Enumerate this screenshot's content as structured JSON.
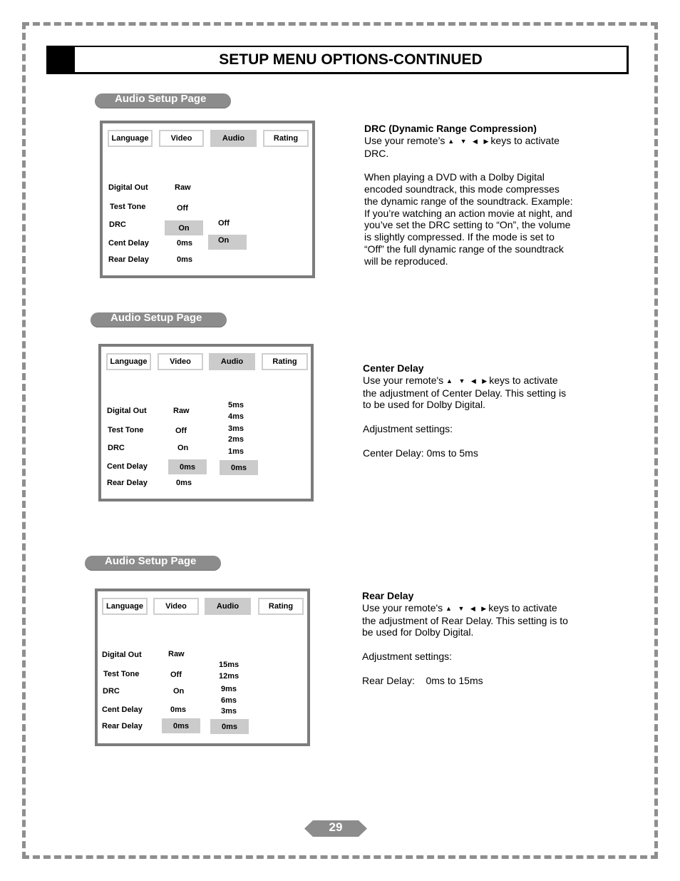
{
  "page": {
    "title": "SETUP MENU OPTIONS-CONTINUED",
    "page_number": "29"
  },
  "common": {
    "section_label": "Audio Setup Page",
    "tabs": [
      "Language",
      "Video",
      "Audio",
      "Rating"
    ],
    "active_tab": "Audio",
    "settings_labels": [
      "Digital Out",
      "Test Tone",
      "DRC",
      "Cent Delay",
      "Rear Delay"
    ],
    "arrow_keys": "▲ ▼ ◀ ▶"
  },
  "sections": [
    {
      "pill_label": "Audio Setup Page",
      "values": [
        "Raw",
        "Off",
        "On",
        "0ms",
        "0ms"
      ],
      "selected_setting": "DRC",
      "options": [
        "Off",
        "On"
      ],
      "selected_option": "On",
      "heading": "DRC (Dynamic Range Compression)",
      "line1_pre": "Use your remote’s",
      "line1_post": "keys to activate",
      "paragraph1_rest": "DRC.",
      "paragraph2": "When playing a DVD with a Dolby Digital encoded soundtrack, this mode compresses the dynamic range of the soundtrack. Example: If you’re watching an action movie at night, and you’ve set the DRC setting to “On”, the volume is slightly compressed.  If the mode is set to “Off” the full dynamic range of the soundtrack will be reproduced."
    },
    {
      "pill_label": "Audio Setup Page",
      "values": [
        "Raw",
        "Off",
        "On",
        "0ms",
        "0ms"
      ],
      "selected_setting": "Cent Delay",
      "options": [
        "5ms",
        "4ms",
        "3ms",
        "2ms",
        "1ms",
        "0ms"
      ],
      "selected_option": "0ms",
      "heading": "Center Delay",
      "line1_pre": "Use your remote's",
      "line1_post": "keys to activate",
      "paragraph1_rest": "the adjustment of Center Delay.  This setting is to be used for Dolby Digital.",
      "adjustment_label": "Adjustment settings:",
      "range_text": "Center Delay: 0ms to 5ms"
    },
    {
      "pill_label": "Audio Setup Page",
      "values": [
        "Raw",
        "Off",
        "On",
        "0ms",
        "0ms"
      ],
      "selected_setting": "Rear Delay",
      "options": [
        "15ms",
        "12ms",
        "9ms",
        "6ms",
        "3ms",
        "0ms"
      ],
      "selected_option": "0ms",
      "heading": "Rear Delay",
      "line1_pre": "Use your remote's",
      "line1_post": "keys to activate",
      "paragraph1_rest": "the adjustment of Rear Delay.  This setting is to be used for Dolby Digital.",
      "adjustment_label": "Adjustment settings:",
      "range_text": "Rear Delay:    0ms to 15ms"
    }
  ]
}
